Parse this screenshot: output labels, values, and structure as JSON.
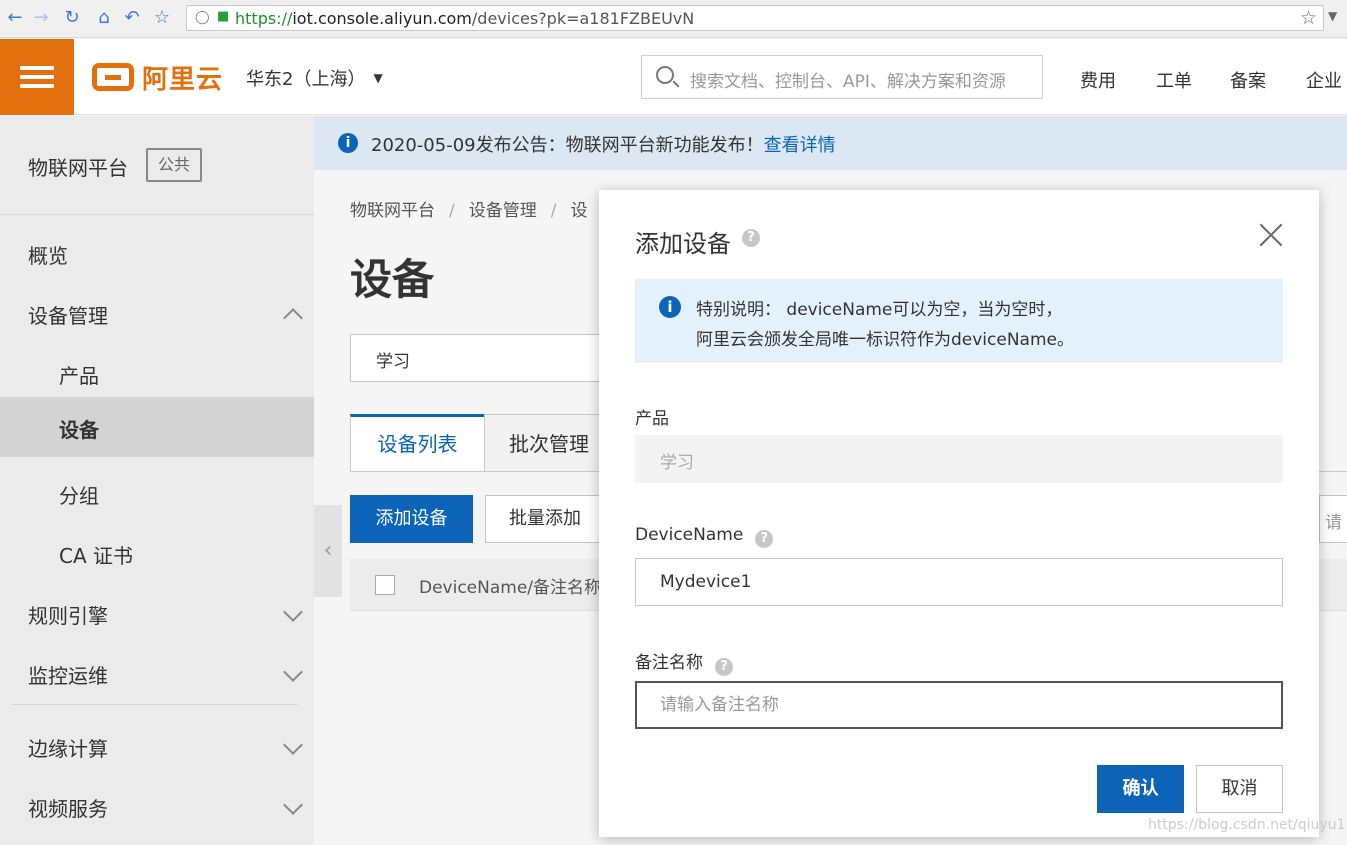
{
  "browser": {
    "url_scheme": "https://",
    "url_host": "iot.console.aliyun.com",
    "url_path": "/devices?pk=a181FZBEUvN"
  },
  "header": {
    "logo_text": "阿里云",
    "region": "华东2（上海）",
    "search_placeholder": "搜索文档、控制台、API、解决方案和资源",
    "nav": [
      "费用",
      "工单",
      "备案",
      "企业"
    ]
  },
  "sidebar": {
    "title": "物联网平台",
    "badge": "公共",
    "items": [
      {
        "label": "概览"
      },
      {
        "label": "设备管理"
      },
      {
        "label": "产品"
      },
      {
        "label": "设备"
      },
      {
        "label": "分组"
      },
      {
        "label": "CA 证书"
      },
      {
        "label": "规则引擎"
      },
      {
        "label": "监控运维"
      },
      {
        "label": "边缘计算"
      },
      {
        "label": "视频服务"
      }
    ]
  },
  "notice": {
    "text": "2020-05-09发布公告：物联网平台新功能发布！",
    "link": "查看详情"
  },
  "main": {
    "breadcrumb": [
      "物联网平台",
      "设备管理",
      "设"
    ],
    "title": "设备",
    "product_select": "学习",
    "tabs": [
      "设备列表",
      "批次管理"
    ],
    "add_button": "添加设备",
    "batch_button": "批量添加",
    "right_input_fragment": "请",
    "table_col": "DeviceName/备注名称"
  },
  "modal": {
    "title": "添加设备",
    "info_line1": "特别说明： deviceName可以为空，当为空时，",
    "info_line2": "阿里云会颁发全局唯一标识符作为deviceName。",
    "product_label": "产品",
    "product_value": "学习",
    "devicename_label": "DeviceName",
    "devicename_value": "Mydevice1",
    "remark_label": "备注名称",
    "remark_placeholder": "请输入备注名称",
    "ok": "确认",
    "cancel": "取消"
  },
  "watermark": "https://blog.csdn.net/qiuyu1"
}
